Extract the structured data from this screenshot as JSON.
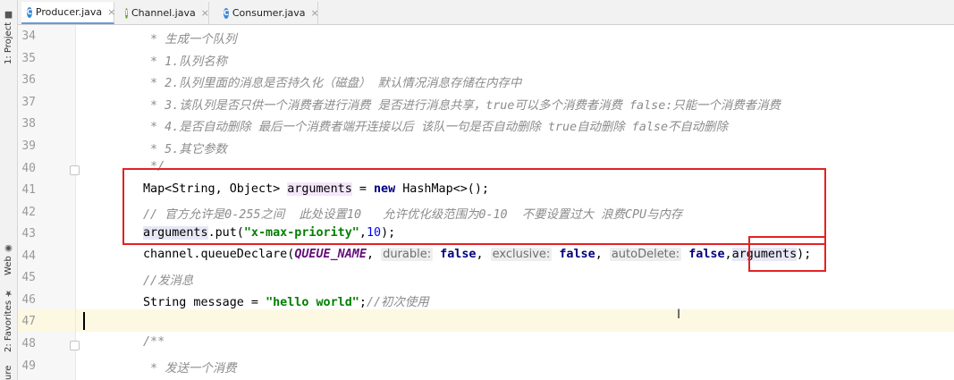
{
  "sidebar": {
    "project_label": "1: Project",
    "web_label": "Web",
    "favorites_label": "2: Favorites",
    "structure_label": "ure"
  },
  "tabs": [
    {
      "label": "Producer.java",
      "icon": "C",
      "icon_color": "#3d8ad6",
      "active": true
    },
    {
      "label": "Channel.java",
      "icon": "I",
      "icon_color": "#6f9b3a",
      "active": false
    },
    {
      "label": "Consumer.java",
      "icon": "C",
      "icon_color": "#3d8ad6",
      "active": false
    }
  ],
  "tab_close": "×",
  "lines": [
    {
      "num": "34",
      "text": " * 生成一个队列"
    },
    {
      "num": "35",
      "text": " * 1.队列名称"
    },
    {
      "num": "36",
      "text": " * 2.队列里面的消息是否持久化（磁盘） 默认情况消息存储在内存中"
    },
    {
      "num": "37",
      "text": " * 3.该队列是否只供一个消费者进行消费 是否进行消息共享，true可以多个消费者消费 false:只能一个消费者消费"
    },
    {
      "num": "38",
      "text": " * 4.是否自动删除 最后一个消费者端开连接以后 该队一句是否自动删除 true自动删除 false不自动删除"
    },
    {
      "num": "39",
      "text": " * 5.其它参数"
    },
    {
      "num": "40",
      "text": " */"
    },
    {
      "num": "41"
    },
    {
      "num": "42",
      "text": "// 官方允许是0-255之间  此处设置10   允许优化级范围为0-10  不要设置过大 浪费CPU与内存"
    },
    {
      "num": "43"
    },
    {
      "num": "44"
    },
    {
      "num": "45",
      "text": "//发消息"
    },
    {
      "num": "46"
    },
    {
      "num": "47"
    },
    {
      "num": "48",
      "text": "/**"
    },
    {
      "num": "49",
      "text": " * 发送一个消费"
    }
  ],
  "code41": {
    "a": "Map<String, Object> ",
    "var": "arguments",
    "b": " = ",
    "kw": "new",
    "c": " HashMap<>();"
  },
  "code43": {
    "var": "arguments",
    "a": ".put(",
    "str": "\"x-max-priority\"",
    "b": ",",
    "num": "10",
    "c": ");"
  },
  "code44": {
    "a": "channel.queueDeclare(",
    "const": "QUEUE_NAME",
    "b": ", ",
    "hint1": "durable:",
    "v1": "false",
    "c": ", ",
    "hint2": "exclusive:",
    "v2": "false",
    "d": ", ",
    "hint3": "autoDelete:",
    "v3": "false",
    "e": ",",
    "var": "arguments",
    "f": ");"
  },
  "code46": {
    "a": "String message = ",
    "str": "\"hello world\"",
    "b": ";",
    "cmt": "//初次使用"
  },
  "highlight_color": "#e32222",
  "cursor_glyph": "I"
}
